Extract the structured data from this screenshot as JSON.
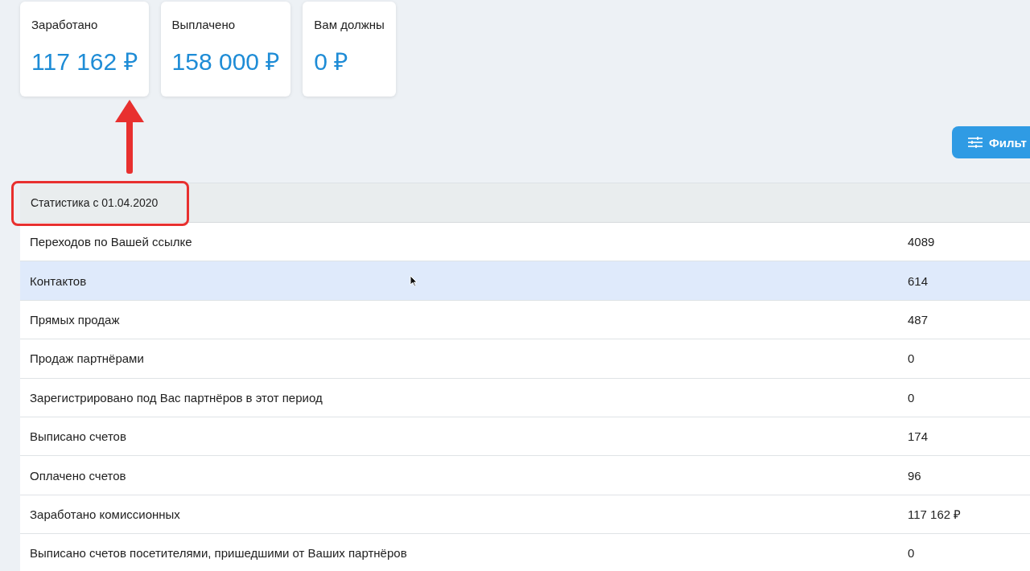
{
  "cards": [
    {
      "label": "Заработано",
      "value": "117 162 ₽"
    },
    {
      "label": "Выплачено",
      "value": "158 000 ₽"
    },
    {
      "label": "Вам должны",
      "value": "0 ₽"
    }
  ],
  "filter_button": {
    "label": "Фильт"
  },
  "table": {
    "header": "Статистика с 01.04.2020",
    "rows": [
      {
        "label": "Переходов по Вашей ссылке",
        "value": "4089",
        "selected": false
      },
      {
        "label": "Контактов",
        "value": "614",
        "selected": true
      },
      {
        "label": "Прямых продаж",
        "value": "487",
        "selected": false
      },
      {
        "label": "Продаж партнёрами",
        "value": "0",
        "selected": false
      },
      {
        "label": "Зарегистрировано под Вас партнёров в этот период",
        "value": "0",
        "selected": false
      },
      {
        "label": "Выписано счетов",
        "value": "174",
        "selected": false
      },
      {
        "label": "Оплачено счетов",
        "value": "96",
        "selected": false
      },
      {
        "label": "Заработано комиссионных",
        "value": "117 162 ₽",
        "selected": false
      },
      {
        "label": "Выписано счетов посетителями, пришедшими от Ваших партнёров",
        "value": "0",
        "selected": false
      }
    ]
  }
}
